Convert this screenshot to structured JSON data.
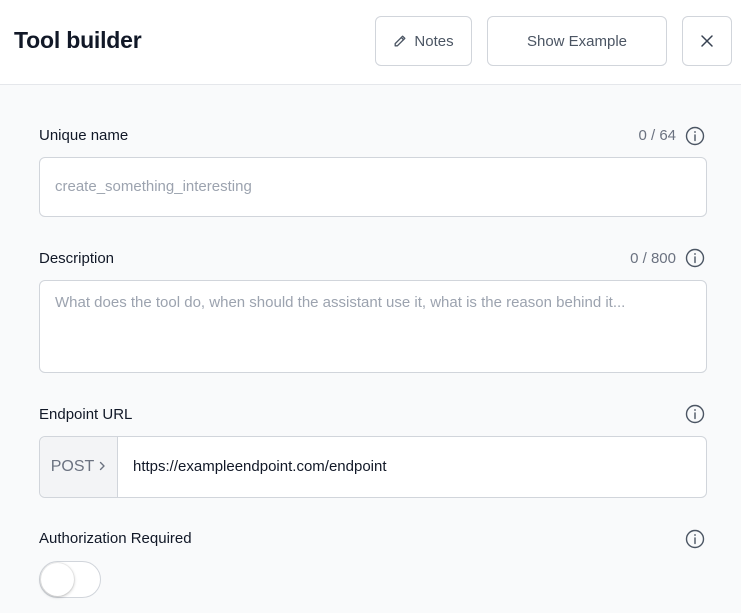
{
  "header": {
    "title": "Tool builder",
    "notes_label": "Notes",
    "show_example_label": "Show Example"
  },
  "fields": {
    "unique_name": {
      "label": "Unique name",
      "counter": "0 / 64",
      "placeholder": "create_something_interesting",
      "value": ""
    },
    "description": {
      "label": "Description",
      "counter": "0 / 800",
      "placeholder": "What does the tool do, when should the assistant use it, what is the reason behind it...",
      "value": ""
    },
    "endpoint_url": {
      "label": "Endpoint URL",
      "method": "POST",
      "value": "https://exampleendpoint.com/endpoint"
    },
    "authorization": {
      "label": "Authorization Required",
      "enabled": false
    }
  },
  "icons": {
    "notes": "pencil-icon",
    "close": "close-icon",
    "info": "info-icon",
    "method_arrow": "chevron-right-icon"
  },
  "colors": {
    "border": "#d1d5db",
    "background": "#f9fafb",
    "muted_text": "#6b7280",
    "placeholder": "#9ca3af"
  }
}
